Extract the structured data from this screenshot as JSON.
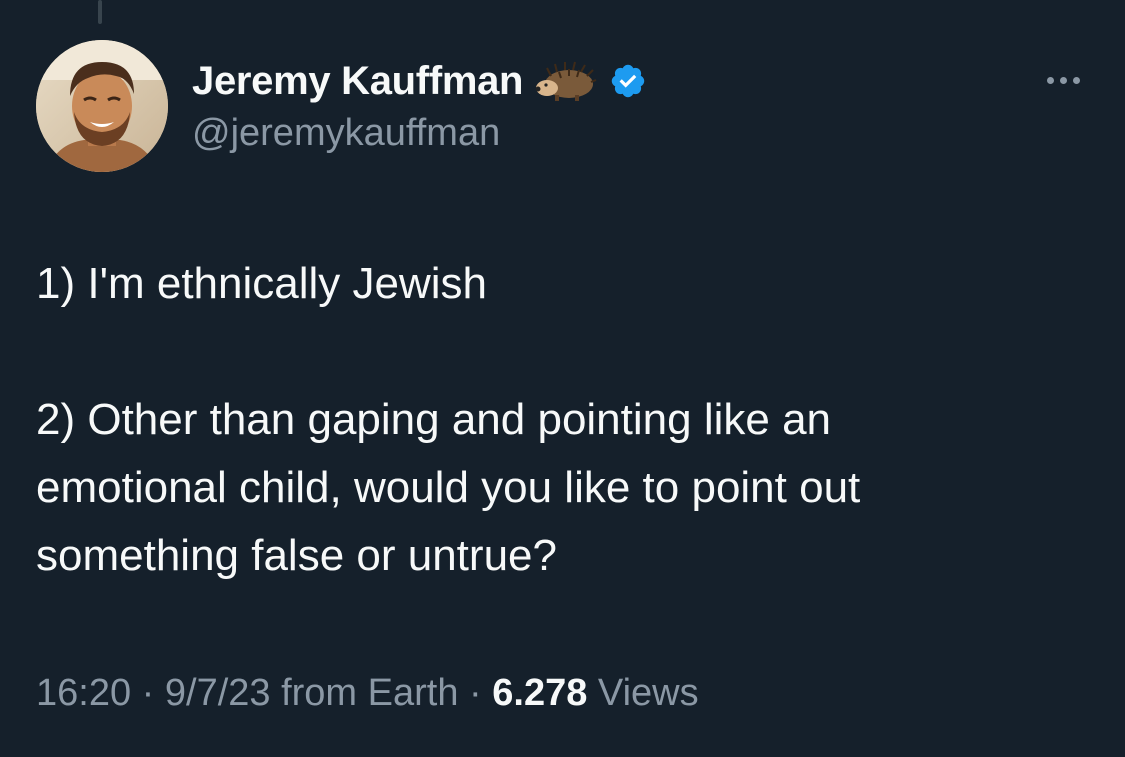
{
  "author": {
    "display_name": "Jeremy Kauffman",
    "handle": "@jeremykauffman",
    "name_emoji": "hedgehog-icon",
    "badge": "verified-icon",
    "badge_color": "#1d9bf0"
  },
  "tweet": {
    "line1": "1) I'm ethnically Jewish",
    "line2": "2) Other than gaping and pointing like an",
    "line3": "emotional child, would you like to point out",
    "line4": "something false or untrue?"
  },
  "meta": {
    "time": "16:20",
    "separator": "·",
    "date_source": "9/7/23 from Earth",
    "views_count": "6.278",
    "views_label": "Views"
  },
  "colors": {
    "background": "#15202b",
    "text_primary": "#f7f9f9",
    "text_secondary": "#8b98a5"
  }
}
